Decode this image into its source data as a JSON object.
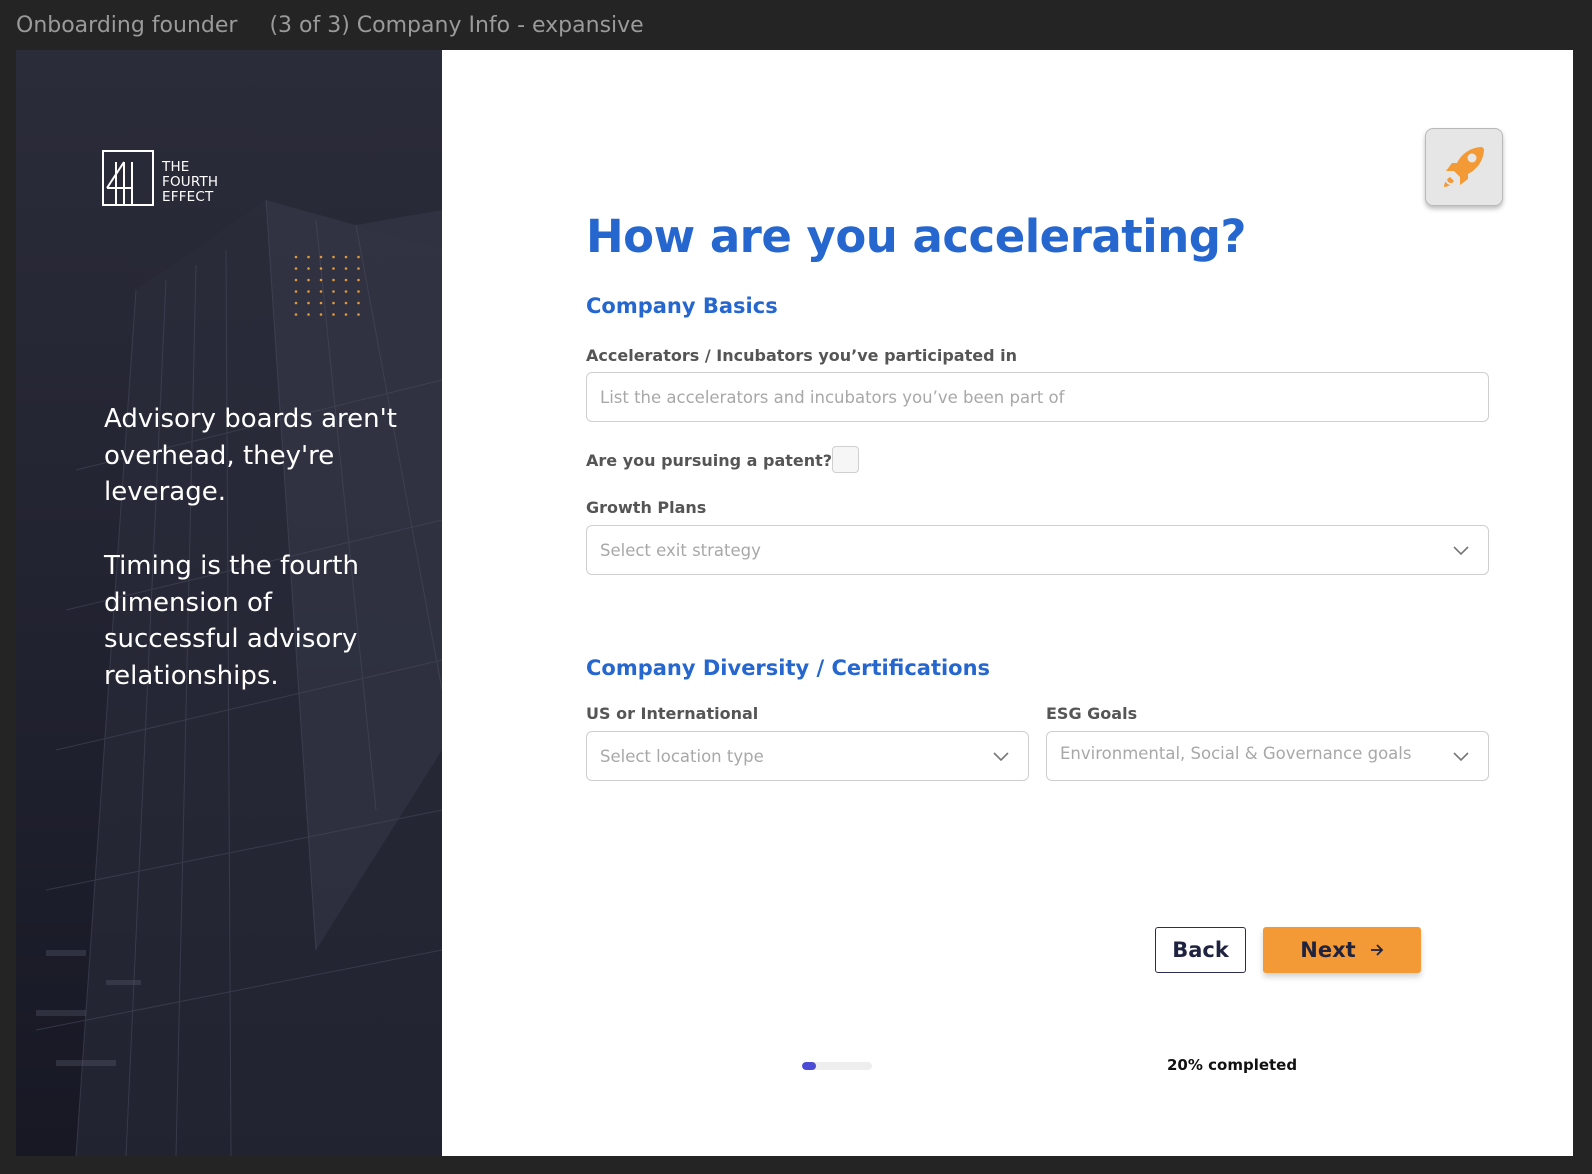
{
  "window": {
    "title": "Onboarding founder",
    "frame_name": "(3 of 3) Company Info - expansive"
  },
  "hero": {
    "logo_lines": [
      "THE",
      "FOURTH",
      "EFFECT"
    ],
    "quote1": "Advisory boards aren't overhead, they're leverage.",
    "quote2": "Timing is the fourth dimension of successful advisory relationships."
  },
  "form": {
    "title": "How are you accelerating?",
    "avatar_icon": "rocket-icon",
    "sections": {
      "basics": "Company Basics",
      "diversity": "Company Diversity / Certifications"
    },
    "accelerators": {
      "label": "Accelerators / Incubators you’ve participated in",
      "placeholder": "List the accelerators and incubators you’ve been part of",
      "value": ""
    },
    "patent": {
      "label": "Are you pursuing a patent?",
      "checked": false
    },
    "growth": {
      "label": "Growth Plans",
      "placeholder": "Select exit strategy"
    },
    "location": {
      "label": "US or International",
      "placeholder": "Select location type"
    },
    "esg": {
      "label": "ESG Goals",
      "placeholder": "Environmental, Social & Governance goals"
    }
  },
  "actions": {
    "back": "Back",
    "next": "Next"
  },
  "progress": {
    "percent": 20,
    "text": "20% completed"
  },
  "colors": {
    "brand_blue": "#2566cf",
    "accent_orange": "#f39a36",
    "progress_indigo": "#4b4bd6",
    "hero_dark": "#232432"
  }
}
